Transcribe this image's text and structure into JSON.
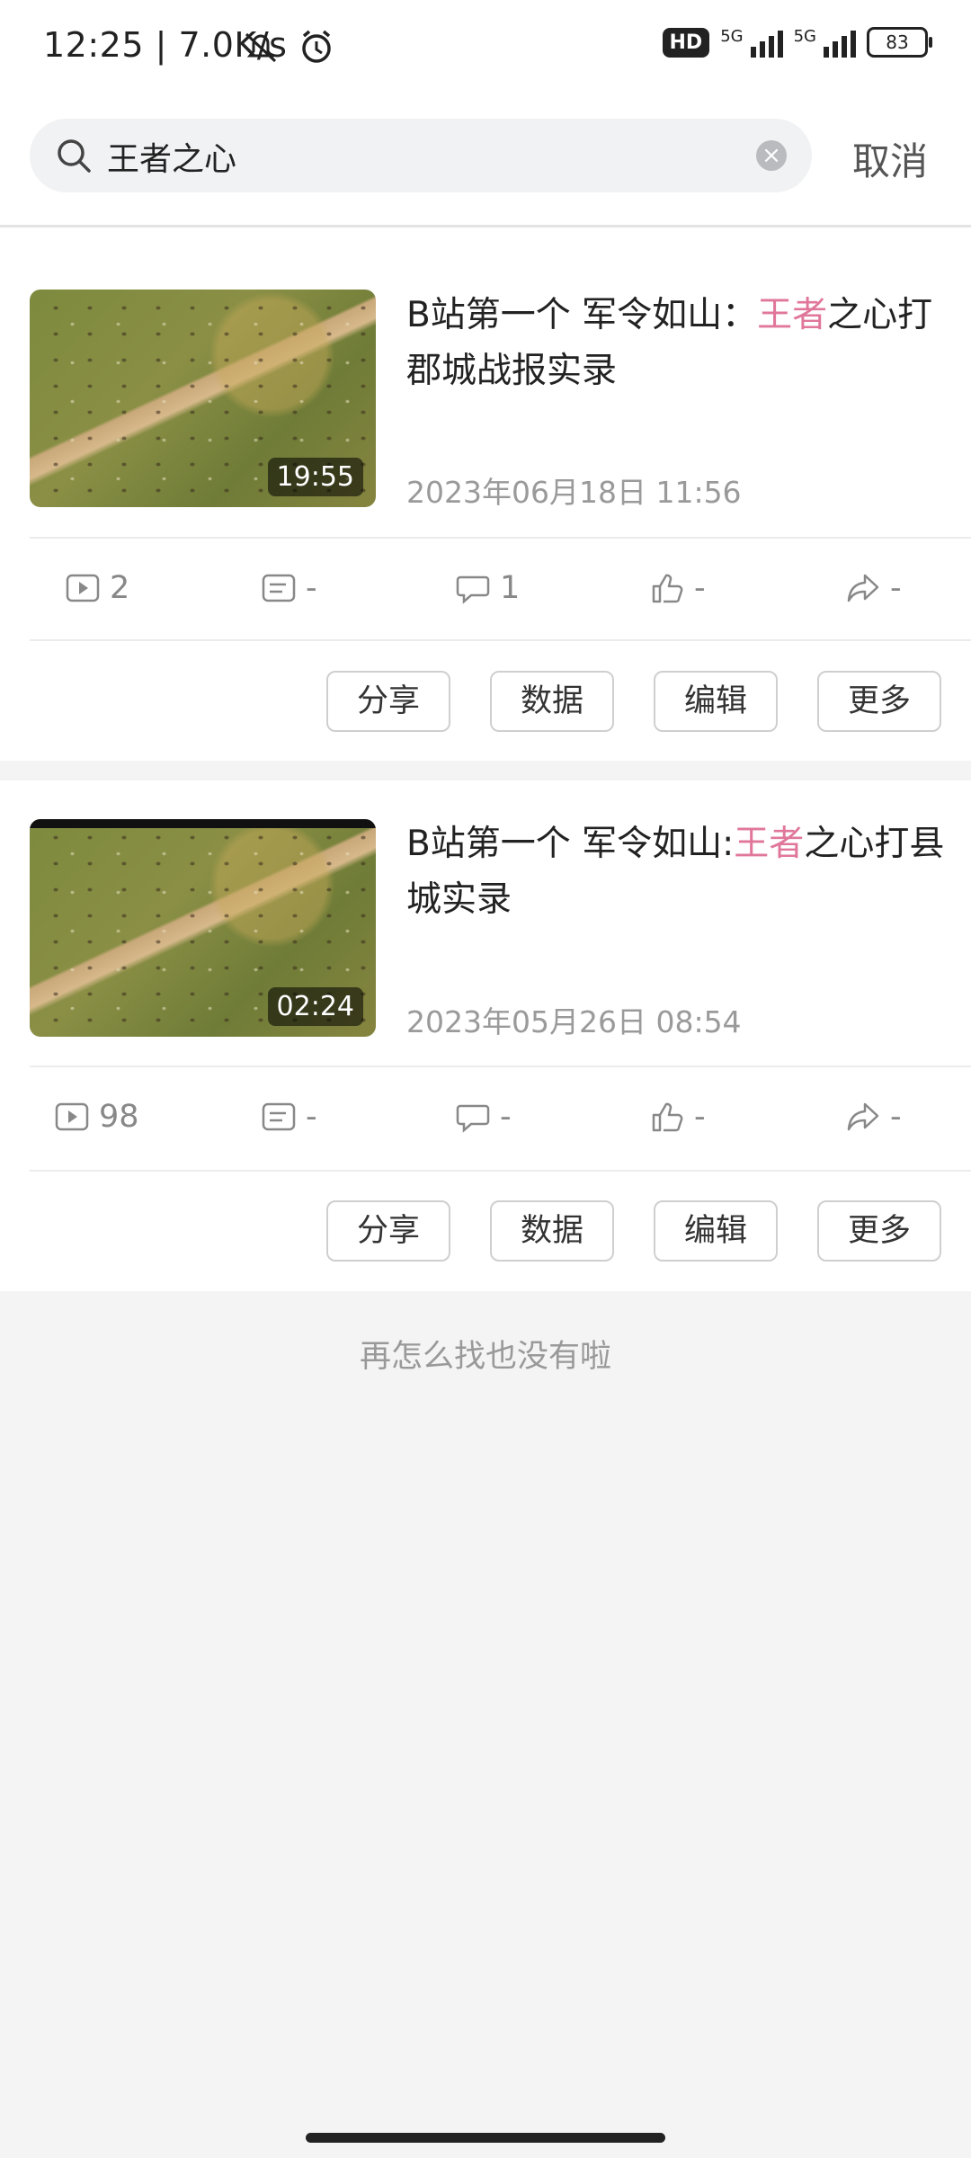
{
  "status_bar": {
    "time_speed": "12:25 | 7.0K/s",
    "hd": "HD",
    "net1": "5G",
    "net2": "5G",
    "battery": "83"
  },
  "search": {
    "value": "王者之心",
    "cancel_label": "取消"
  },
  "videos": [
    {
      "title_before": "B站第一个  军令如山：",
      "title_highlight": "王者",
      "title_after": "之心打郡城战报实录",
      "duration": "19:55",
      "date": "2023年06月18日 11:56",
      "plays": "2",
      "danmaku": "-",
      "comments": "1",
      "likes": "-",
      "shares": "-"
    },
    {
      "title_before": "B站第一个  军令如山:",
      "title_highlight": "王者",
      "title_after": "之心打县城实录",
      "duration": "02:24",
      "date": "2023年05月26日 08:54",
      "plays": "98",
      "danmaku": "-",
      "comments": "-",
      "likes": "-",
      "shares": "-"
    }
  ],
  "actions": {
    "share": "分享",
    "data": "数据",
    "edit": "编辑",
    "more": "更多"
  },
  "end_text": "再怎么找也没有啦",
  "colors": {
    "highlight": "#e0779a",
    "background": "#f4f4f5"
  }
}
